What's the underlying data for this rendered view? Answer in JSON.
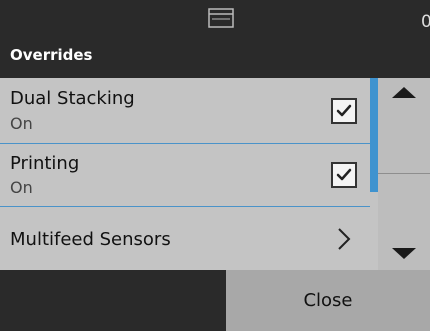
{
  "header": {
    "title": "Overrides",
    "right_text": "0",
    "icon": "panel-icon"
  },
  "list": {
    "items": [
      {
        "label": "Dual Stacking",
        "value": "On",
        "control": "checkbox",
        "checked": true
      },
      {
        "label": "Printing",
        "value": "On",
        "control": "checkbox",
        "checked": true
      },
      {
        "label": "Multifeed Sensors",
        "control": "chevron-right-icon"
      }
    ]
  },
  "scroll": {
    "up_icon": "up-arrow-icon",
    "down_icon": "down-arrow-icon"
  },
  "footer": {
    "close_label": "Close"
  },
  "colors": {
    "header_bg": "#2a2a2a",
    "list_bg": "#c4c4c4",
    "accent": "#3f93cf",
    "button_bg": "#a8a8a8"
  }
}
